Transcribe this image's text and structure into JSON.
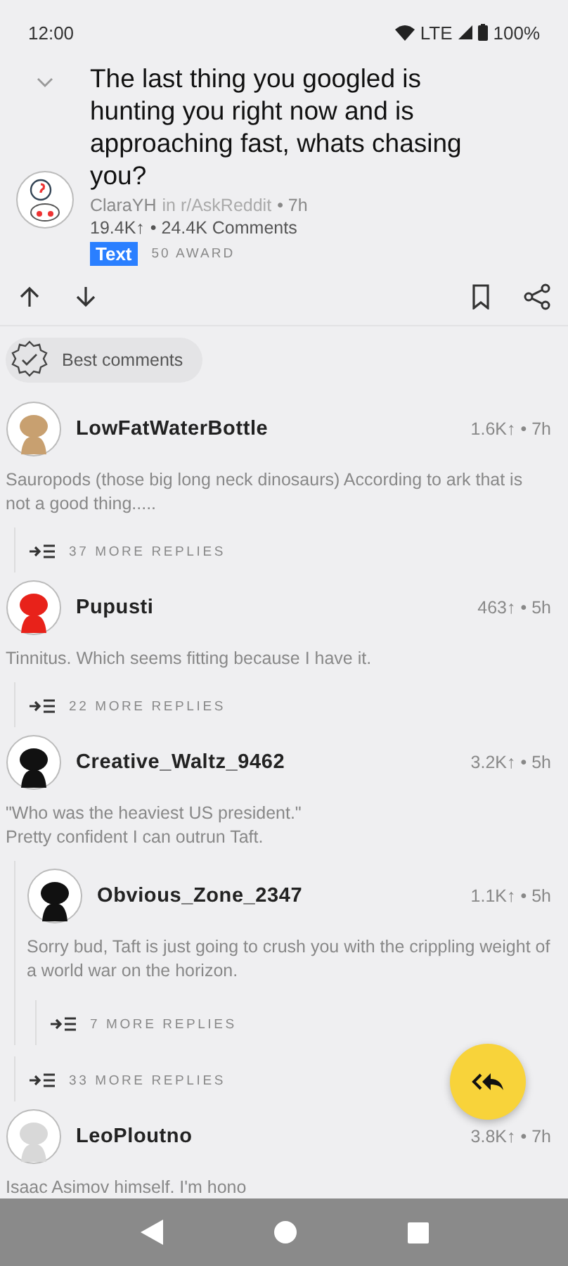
{
  "status_bar": {
    "time": "12:00",
    "network": "LTE",
    "battery": "100%"
  },
  "post": {
    "title": "The last thing you googled is hunting you right now and is approaching fast, whats chasing you?",
    "author": "ClaraYH",
    "subreddit": "in r/AskReddit",
    "age": "• 7h",
    "score": "19.4K↑",
    "comments": "• 24.4K Comments",
    "flair": "Text",
    "awards": "50 AWARD"
  },
  "sort": {
    "label": "Best comments"
  },
  "comments": [
    {
      "user": "LowFatWaterBottle",
      "score": "1.6K↑ • 7h",
      "color": "#c8a070",
      "body": "Sauropods (those big long neck dinosaurs) According to ark that is not a good thing.....",
      "more_replies": "37 MORE REPLIES"
    },
    {
      "user": "Pupusti",
      "score": "463↑ • 5h",
      "color": "#e8221a",
      "body": "Tinnitus. Which seems fitting because I have it.",
      "more_replies": "22 MORE REPLIES"
    },
    {
      "user": "Creative_Waltz_9462",
      "score": "3.2K↑ • 5h",
      "color": "#111111",
      "body": "\"Who was the heaviest US president.\"\nPretty confident I can outrun Taft.",
      "more_replies": "33 MORE REPLIES",
      "children": [
        {
          "user": "Obvious_Zone_2347",
          "score": "1.1K↑ • 5h",
          "color": "#111111",
          "body": "Sorry bud, Taft is just going to crush you with the crippling weight of a world war on the horizon.",
          "more_replies": "7 MORE REPLIES"
        }
      ]
    },
    {
      "user": "LeoPloutno",
      "score": "3.8K↑ • 7h",
      "color": "#d8d8d8",
      "body": "Isaac Asimov himself. I'm hono"
    }
  ]
}
